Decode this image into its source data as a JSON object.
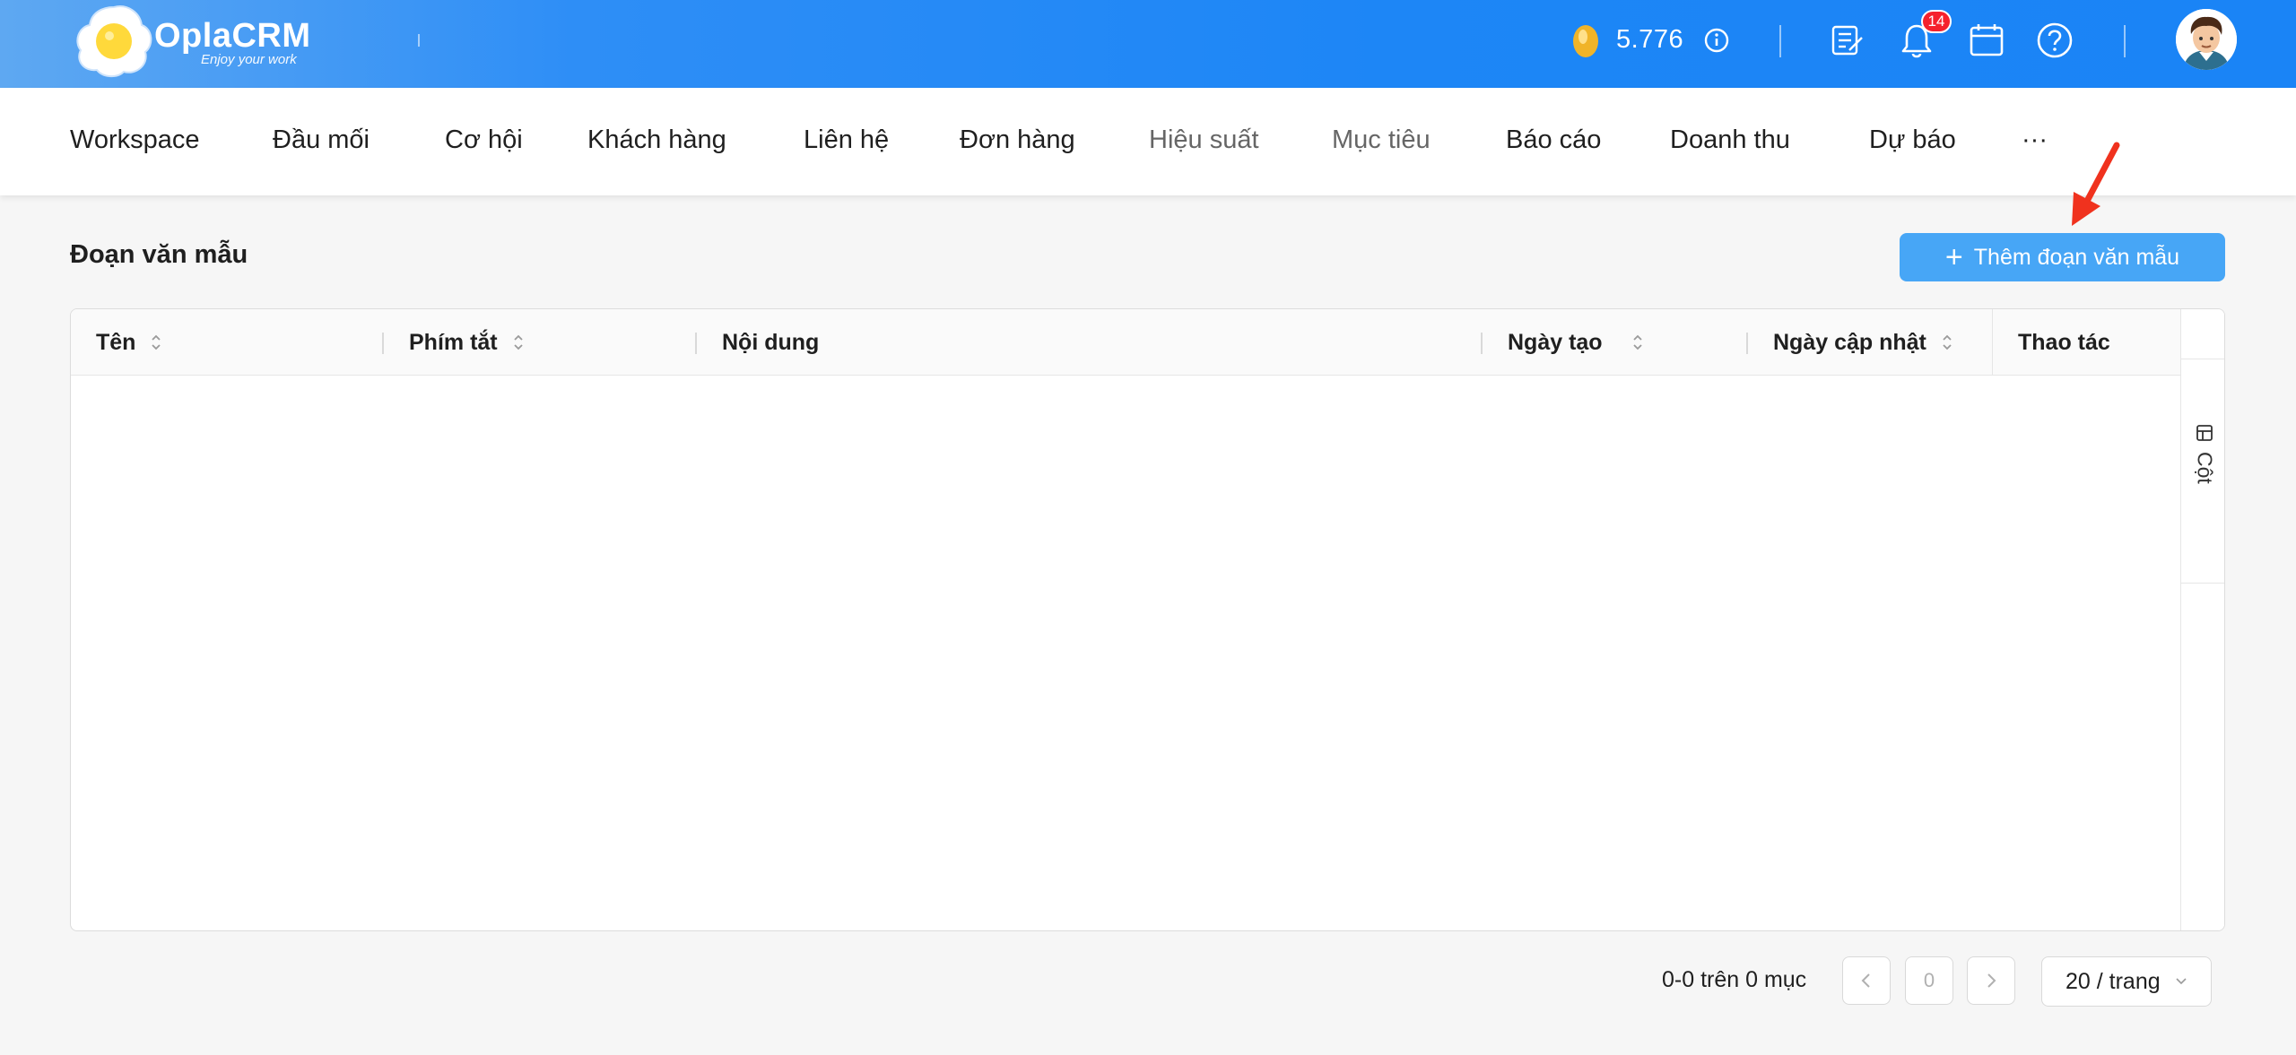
{
  "brand": {
    "name": "OplaCRM",
    "tagline": "Enjoy your work"
  },
  "header": {
    "coin_balance": "5.776",
    "notification_count": "14",
    "icons": [
      "coin-icon",
      "info-icon",
      "checklist-icon",
      "bell-icon",
      "calendar-icon",
      "help-icon",
      "avatar"
    ]
  },
  "nav": {
    "items": [
      {
        "label": "Workspace"
      },
      {
        "label": "Đầu mối"
      },
      {
        "label": "Cơ hội"
      },
      {
        "label": "Khách hàng"
      },
      {
        "label": "Liên hệ"
      },
      {
        "label": "Đơn hàng"
      },
      {
        "label": "Hiệu suất"
      },
      {
        "label": "Mục tiêu"
      },
      {
        "label": "Báo cáo"
      },
      {
        "label": "Doanh thu"
      },
      {
        "label": "Dự báo"
      },
      {
        "label": "···"
      }
    ]
  },
  "page": {
    "title": "Đoạn văn mẫu",
    "add_button": "Thêm đoạn văn mẫu"
  },
  "table": {
    "columns": [
      {
        "label": "Tên",
        "sortable": true
      },
      {
        "label": "Phím tắt",
        "sortable": true
      },
      {
        "label": "Nội dung",
        "sortable": false
      },
      {
        "label": "Ngày tạo",
        "sortable": true
      },
      {
        "label": "Ngày cập nhật",
        "sortable": true
      },
      {
        "label": "Thao tác",
        "sortable": false
      }
    ],
    "rows": [],
    "column_toggle": "Cột"
  },
  "pagination": {
    "info": "0-0 trên 0 mục",
    "current_page": "0",
    "page_size": "20 / trang"
  },
  "colors": {
    "topbar": "#1a84f6",
    "primary_button": "#47a6f6",
    "badge": "#f5222d",
    "annotation_arrow": "#f0321e"
  }
}
